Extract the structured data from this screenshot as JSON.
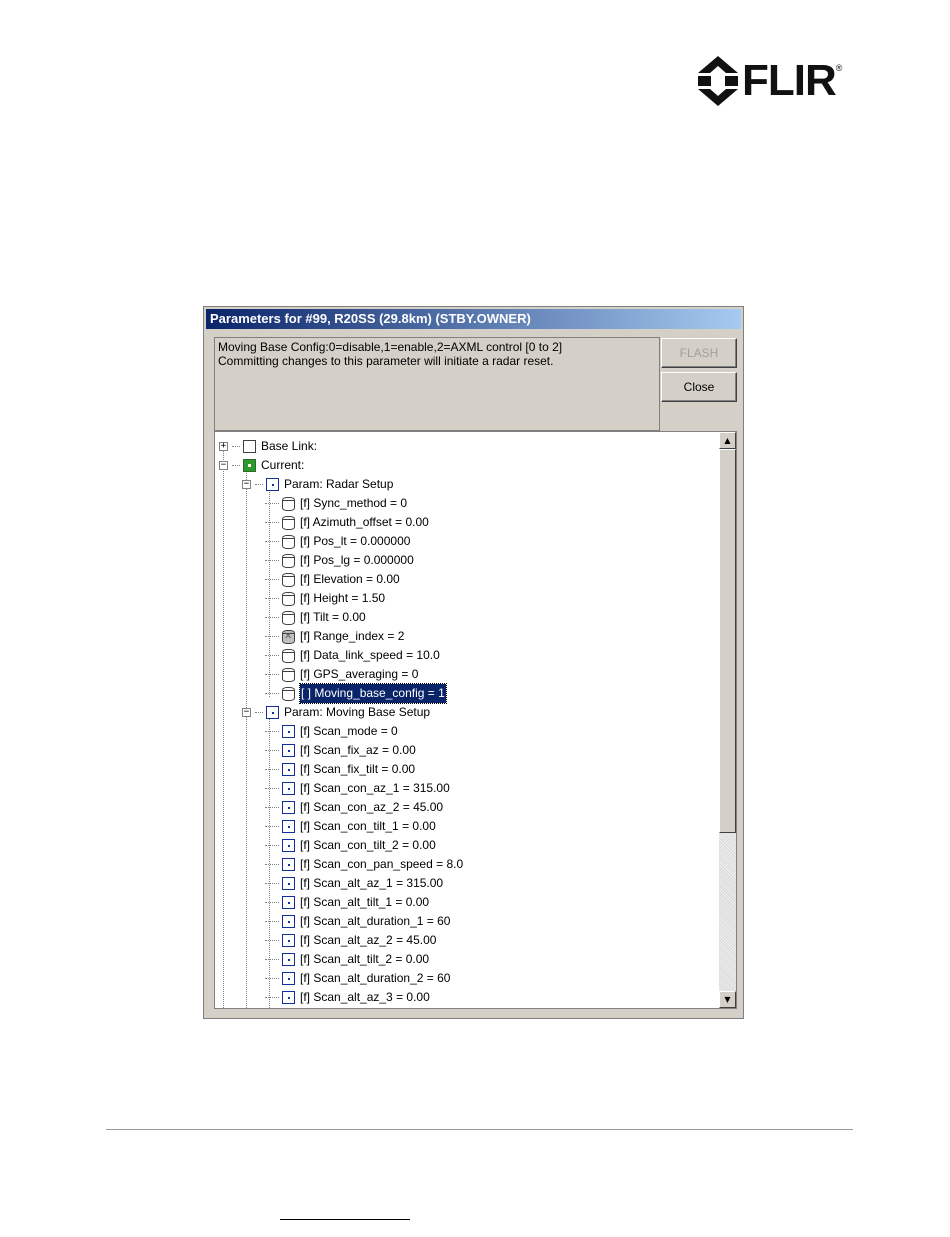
{
  "logo": {
    "text": "FLIR",
    "registered": "®"
  },
  "dialog": {
    "title": "Parameters for #99, R20SS (29.8km) (STBY.OWNER)",
    "description": [
      "Moving Base Config:0=disable,1=enable,2=AXML control [0 to 2]",
      "Committing changes to this parameter will initiate a radar reset."
    ],
    "flash_label": "FLASH",
    "close_label": "Close"
  },
  "tree": {
    "base_link": "Base Link:",
    "current": "Current:",
    "radar_setup": {
      "label": "Param: Radar Setup",
      "items": [
        {
          "label": "[f] Sync_method = 0",
          "icon": "cylinder"
        },
        {
          "label": "[f] Azimuth_offset = 0.00",
          "icon": "cylinder"
        },
        {
          "label": "[f] Pos_lt = 0.000000",
          "icon": "cylinder"
        },
        {
          "label": "[f] Pos_lg = 0.000000",
          "icon": "cylinder"
        },
        {
          "label": "[f] Elevation = 0.00",
          "icon": "cylinder"
        },
        {
          "label": "[f] Height = 1.50",
          "icon": "cylinder"
        },
        {
          "label": "[f] Tilt = 0.00",
          "icon": "cylinder"
        },
        {
          "label": "[f] Range_index = 2",
          "icon": "cylinder-x"
        },
        {
          "label": "[f] Data_link_speed = 10.0",
          "icon": "cylinder"
        },
        {
          "label": "[f] GPS_averaging = 0",
          "icon": "cylinder"
        },
        {
          "label": "[ ] Moving_base_config = 1",
          "icon": "cylinder",
          "selected": true
        }
      ]
    },
    "moving_base_setup": {
      "label": "Param: Moving Base Setup",
      "items": [
        "[f] Scan_mode = 0",
        "[f] Scan_fix_az = 0.00",
        "[f] Scan_fix_tilt = 0.00",
        "[f] Scan_con_az_1 = 315.00",
        "[f] Scan_con_az_2 = 45.00",
        "[f] Scan_con_tilt_1 = 0.00",
        "[f] Scan_con_tilt_2 = 0.00",
        "[f] Scan_con_pan_speed = 8.0",
        "[f] Scan_alt_az_1 = 315.00",
        "[f] Scan_alt_tilt_1 = 0.00",
        "[f] Scan_alt_duration_1 = 60",
        "[f] Scan_alt_az_2 = 45.00",
        "[f] Scan_alt_tilt_2 = 0.00",
        "[f] Scan_alt_duration_2 = 60",
        "[f] Scan_alt_az_3 = 0.00"
      ]
    }
  },
  "colors": {
    "title_start": "#0a246a",
    "title_end": "#a6caf0",
    "selection": "#0a246a",
    "current_icon": "#2b9a2b"
  }
}
